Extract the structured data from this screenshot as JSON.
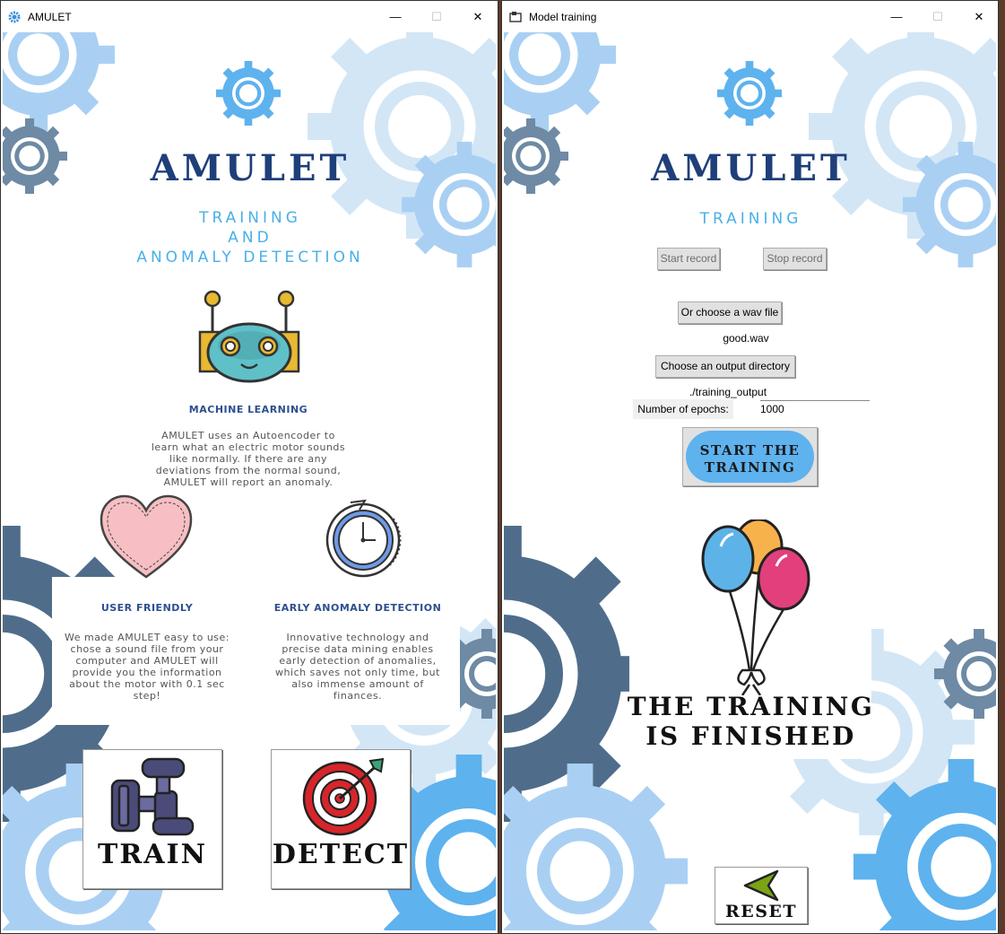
{
  "window1": {
    "title": "AMULET",
    "controls": {
      "minimize": "—",
      "maximize": "☐",
      "close": "✕"
    },
    "app_name": "AMULET",
    "subtitle_lines": [
      "TRAINING",
      "AND",
      "ANOMALY DETECTION"
    ],
    "features": {
      "machine_learning": {
        "title": "MACHINE LEARNING",
        "text": [
          "AMULET uses an Autoencoder to",
          "learn what an electric motor sounds",
          "like normally. If there are any",
          "deviations from the normal sound,",
          "AMULET will report an anomaly."
        ]
      },
      "user_friendly": {
        "title": "USER FRIENDLY",
        "text": [
          "We made AMULET easy to use:",
          "chose a sound file from your",
          "computer and AMULET will",
          "provide you the information",
          "about the motor with 0.1 sec",
          "step!"
        ]
      },
      "early_detection": {
        "title": "EARLY ANOMALY DETECTION",
        "text": [
          "Innovative technology and",
          "precise data mining enables",
          "early detection of anomalies,",
          "which saves not only time, but",
          "also immense amount of",
          "finances."
        ]
      }
    },
    "train_label": "TRAIN",
    "detect_label": "DETECT"
  },
  "window2": {
    "title": "Model training",
    "controls": {
      "minimize": "—",
      "maximize": "☐",
      "close": "✕"
    },
    "app_name": "AMULET",
    "subtitle": "TRAINING",
    "start_record": "Start record",
    "stop_record": "Stop record",
    "choose_wav": "Or choose a wav file",
    "wav_file": "good.wav",
    "choose_dir": "Choose an output directory",
    "output_dir": "./training_output",
    "epochs_label": "Number of epochs:",
    "epochs_value": "1000",
    "start_training_lines": [
      "START THE",
      "TRAINING"
    ],
    "finished_lines": [
      "THE TRAINING",
      "IS FINISHED"
    ],
    "reset_label": "RESET"
  },
  "colors": {
    "dark_blue": "#1f3f7a",
    "light_blue": "#48b0e8",
    "gear_pale": "#d3e6f6",
    "gear_mid": "#a9d0f3",
    "gear_slate": "#4f6d8a",
    "gear_bright": "#5eb2ee"
  }
}
